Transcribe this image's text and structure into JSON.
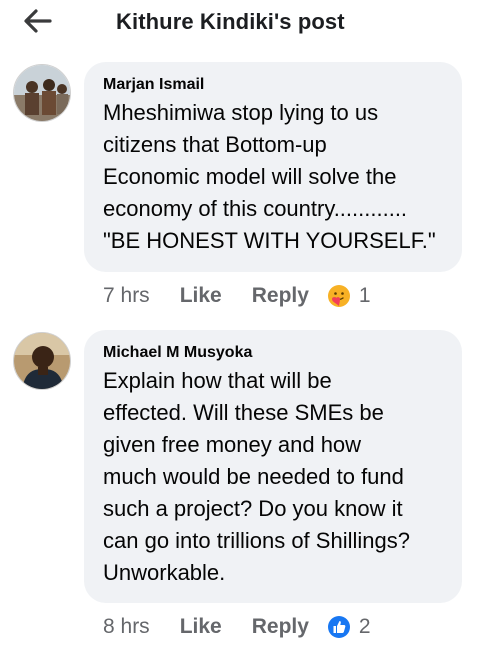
{
  "header": {
    "title": "Kithure Kindiki's post",
    "back_icon": "back-arrow-icon"
  },
  "comments": [
    {
      "author": "Marjan Ismail",
      "lines": [
        "Mheshimiwa stop lying to us",
        "citizens that Bottom-up",
        "Economic model will solve the",
        "economy of this country............",
        "\"BE HONEST WITH YOURSELF.\""
      ],
      "time": "7 hrs",
      "like_label": "Like",
      "reply_label": "Reply",
      "reaction_icon": "care-reaction-icon",
      "reaction_count": "1"
    },
    {
      "author": "Michael M Musyoka",
      "lines": [
        "Explain how that will be",
        "effected. Will these SMEs  be",
        "given free money and how",
        "much would be needed to fund",
        "such a project? Do you know it",
        "can go into trillions of Shillings?",
        "Unworkable."
      ],
      "time": "8 hrs",
      "like_label": "Like",
      "reply_label": "Reply",
      "reaction_icon": "like-reaction-icon",
      "reaction_count": "2"
    }
  ],
  "colors": {
    "bubble": "#f0f2f5",
    "meta_text": "#65676b",
    "like_blue": "#1877f2",
    "care_yellow": "#f7b125"
  }
}
